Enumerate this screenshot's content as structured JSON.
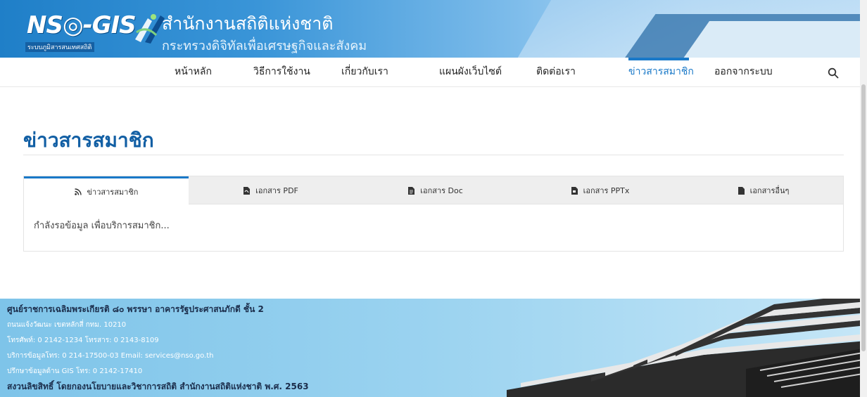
{
  "header": {
    "logo_text": "NS◎-GIS",
    "logo_subtitle": "ระบบภูมิสารสนเทศสถิติ",
    "org_title": "สำนักงานสถิติแห่งชาติ",
    "org_subtitle": "กระทรวงดิจิทัลเพื่อเศรษฐกิจและสังคม"
  },
  "nav": {
    "items": [
      {
        "label": "หน้าหลัก"
      },
      {
        "label": "วิธีการใช้งาน"
      },
      {
        "label": "เกี่ยวกับเรา"
      },
      {
        "label": "แผนผังเว็บไซต์"
      },
      {
        "label": "ติดต่อเรา"
      },
      {
        "label": "ข่าวสารสมาชิก"
      },
      {
        "label": "ออกจากระบบ"
      }
    ],
    "active_index": 5,
    "search_icon": "search-icon"
  },
  "main": {
    "title": "ข่าวสารสมาชิก",
    "tabs": [
      {
        "label": "ข่าวสารสมาชิก",
        "icon": "rss-icon"
      },
      {
        "label": "เอกสาร PDF",
        "icon": "file-pdf-icon"
      },
      {
        "label": "เอกสาร Doc",
        "icon": "file-doc-icon"
      },
      {
        "label": "เอกสาร PPTx",
        "icon": "file-ppt-icon"
      },
      {
        "label": "เอกสารอื่นๆ",
        "icon": "file-icon"
      }
    ],
    "active_tab": 0,
    "loading_text": "กำลังรอข้อมูล เพื่อบริการสมาชิก..."
  },
  "footer": {
    "lines": [
      "ศูนย์ราชการเฉลิมพระเกียรติ ๘๐ พรรษา อาคารรัฐประศาสนภักดี ชั้น 2",
      "ถนนแจ้งวัฒนะ เขตหลักสี่ กทม. 10210",
      "โทรศัพท์: 0 2142-1234 โทรสาร: 0 2143-8109",
      "บริการข้อมูลโทร: 0 214-17500-03 Email: services@nso.go.th",
      "ปรึกษาข้อมูลด้าน GIS โทร: 0 2142-17410",
      "สงวนลิขสิทธิ์ โดยกองนโยบายและวิชาการสถิติ สำนักงานสถิติแห่งชาติ พ.ศ. 2563"
    ]
  },
  "colors": {
    "accent": "#1a79c8",
    "title": "#125fa4",
    "footer_bg": "#9bd3f0"
  }
}
